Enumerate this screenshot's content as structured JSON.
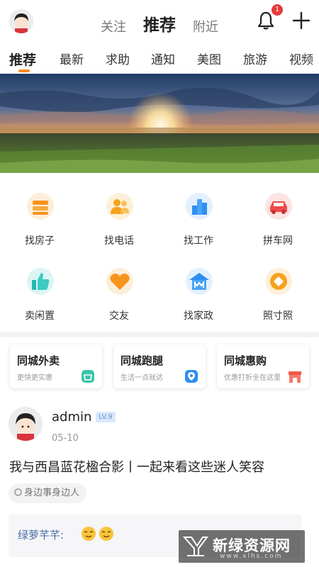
{
  "top_tabs": [
    "关注",
    "推荐",
    "附近"
  ],
  "notification_count": "1",
  "categories": [
    "推荐",
    "最新",
    "求助",
    "通知",
    "美图",
    "旅游",
    "视频"
  ],
  "grid": [
    {
      "label": "找房子",
      "icon": "house-icon",
      "color": "#f7941d"
    },
    {
      "label": "找电话",
      "icon": "contacts-icon",
      "color": "#f7a21d"
    },
    {
      "label": "找工作",
      "icon": "building-icon",
      "color": "#2e8ef0"
    },
    {
      "label": "拼车网",
      "icon": "car-icon",
      "color": "#ef4a4a"
    },
    {
      "label": "卖闲置",
      "icon": "thumbs-up-icon",
      "color": "#22b8b0"
    },
    {
      "label": "交友",
      "icon": "heart-icon",
      "color": "#f7941d"
    },
    {
      "label": "找家政",
      "icon": "housekeeping-icon",
      "color": "#2e8ef0"
    },
    {
      "label": "照寸照",
      "icon": "photo-icon",
      "color": "#f7a21d"
    }
  ],
  "services": [
    {
      "title": "同城外卖",
      "subtitle": "更快更实惠",
      "icon": "takeout-icon",
      "color": "#3dc4a6"
    },
    {
      "title": "同城跑腿",
      "subtitle": "生活一点就达",
      "icon": "errand-icon",
      "color": "#2e8ef0"
    },
    {
      "title": "同城惠购",
      "subtitle": "优惠打折全在这里",
      "icon": "shop-icon",
      "color": "#ef5a4a"
    }
  ],
  "post": {
    "username": "admin",
    "level": "LV.9",
    "date": "05-10",
    "title": "我与西昌蓝花楹合影丨一起来看这些迷人笑容",
    "tag": "身边事身边人",
    "comment_author": "绿萝芊芊:"
  },
  "watermark": {
    "text": "新绿资源网",
    "url": "www.xlhs.com"
  }
}
